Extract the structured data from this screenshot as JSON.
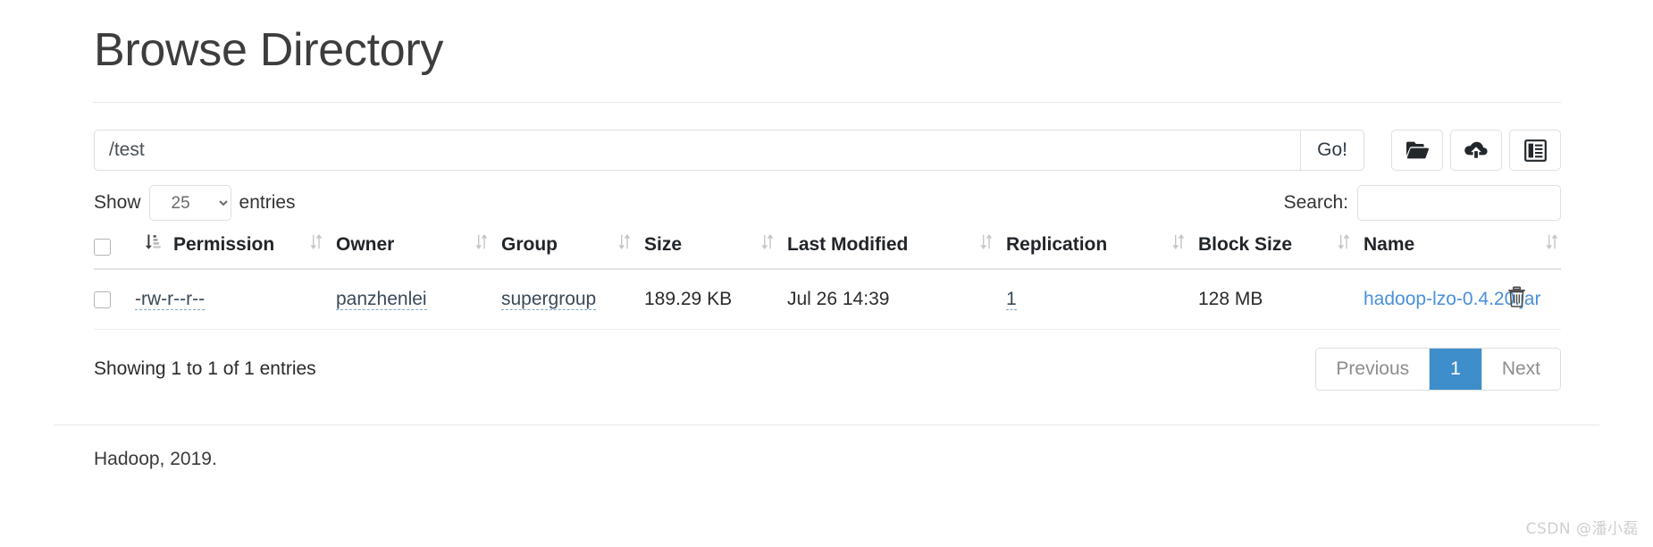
{
  "header": {
    "title": "Browse Directory"
  },
  "pathbar": {
    "path_value": "/test",
    "path_placeholder": "",
    "go_label": "Go!",
    "buttons": [
      {
        "name": "create-directory-button",
        "icon": "open-folder-icon"
      },
      {
        "name": "upload-files-button",
        "icon": "cloud-upload-icon"
      },
      {
        "name": "cut-paste-button",
        "icon": "clipboard-list-icon"
      }
    ]
  },
  "controls": {
    "show_label": "Show",
    "entries_label": "entries",
    "entries_selected": "25",
    "entries_options": [
      "25"
    ],
    "search_label": "Search:",
    "search_value": "",
    "search_placeholder": ""
  },
  "table": {
    "columns": [
      {
        "key": "check",
        "label": ""
      },
      {
        "key": "permission",
        "label": "Permission"
      },
      {
        "key": "owner",
        "label": "Owner"
      },
      {
        "key": "group",
        "label": "Group"
      },
      {
        "key": "size",
        "label": "Size"
      },
      {
        "key": "modified",
        "label": "Last Modified"
      },
      {
        "key": "replication",
        "label": "Replication"
      },
      {
        "key": "blocksize",
        "label": "Block Size"
      },
      {
        "key": "name",
        "label": "Name"
      }
    ],
    "rows": [
      {
        "permission": "-rw-r--r--",
        "owner": "panzhenlei",
        "group": "supergroup",
        "size": "189.29 KB",
        "modified": "Jul 26 14:39",
        "replication": "1",
        "blocksize": "128 MB",
        "name": "hadoop-lzo-0.4.20.jar"
      }
    ]
  },
  "footer_bar": {
    "showing_info": "Showing 1 to 1 of 1 entries",
    "pagination": {
      "previous_label": "Previous",
      "next_label": "Next",
      "pages": [
        "1"
      ],
      "active_page": "1"
    }
  },
  "site_footer": {
    "text": "Hadoop, 2019."
  },
  "watermark": {
    "text": "CSDN @潘小磊"
  },
  "colors": {
    "accent": "#3e8ecb",
    "link": "#4a90d9",
    "title": "#3d3d3d",
    "border": "#dfdfdf"
  }
}
